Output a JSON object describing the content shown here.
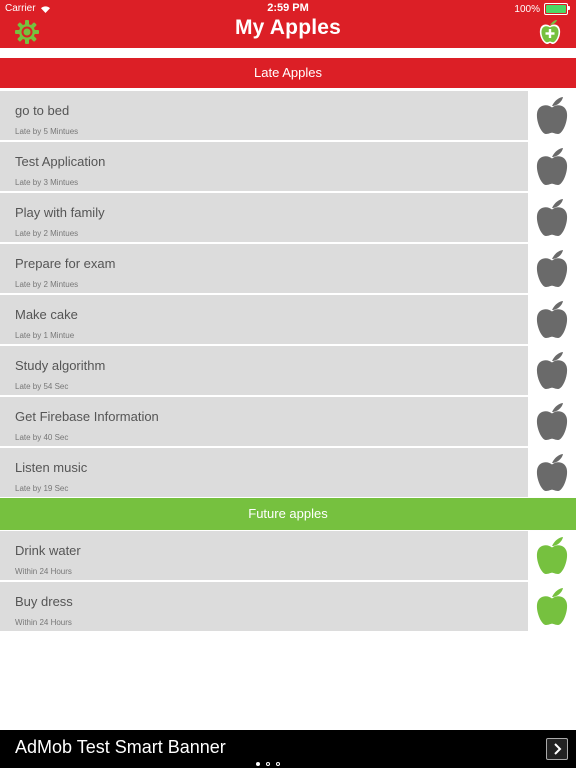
{
  "status_bar": {
    "carrier": "Carrier",
    "time": "2:59 PM",
    "battery": "100%",
    "battery_level": 1.0
  },
  "nav": {
    "title": "My Apples",
    "left_icon": "gear-icon",
    "right_icon": "apple-add-icon"
  },
  "sections": {
    "late_header": "Late Apples",
    "future_header": "Future apples"
  },
  "late_items": [
    {
      "title": "go to bed",
      "subtitle": "Late by 5 Mintues"
    },
    {
      "title": "Test Application",
      "subtitle": "Late by 3 Mintues"
    },
    {
      "title": "Play with family",
      "subtitle": "Late by 2 Mintues"
    },
    {
      "title": "Prepare for exam",
      "subtitle": "Late by 2 Mintues"
    },
    {
      "title": "Make cake",
      "subtitle": "Late by 1 Mintue"
    },
    {
      "title": "Study algorithm",
      "subtitle": "Late by 54 Sec"
    },
    {
      "title": "Get Firebase Information",
      "subtitle": "Late by 40 Sec"
    },
    {
      "title": "Listen music",
      "subtitle": "Late by 19 Sec"
    }
  ],
  "future_items": [
    {
      "title": "Drink water",
      "subtitle": "Within 24 Hours"
    },
    {
      "title": "Buy dress",
      "subtitle": "Within 24 Hours"
    }
  ],
  "ad": {
    "text": "AdMob Test Smart Banner",
    "arrow_icon": "chevron-right-icon"
  },
  "colors": {
    "primary_red": "#dc1f26",
    "future_green": "#76c13f",
    "late_apple": "#6a6a6a",
    "future_apple": "#76c13f",
    "row_bg": "#dcdcdc"
  }
}
